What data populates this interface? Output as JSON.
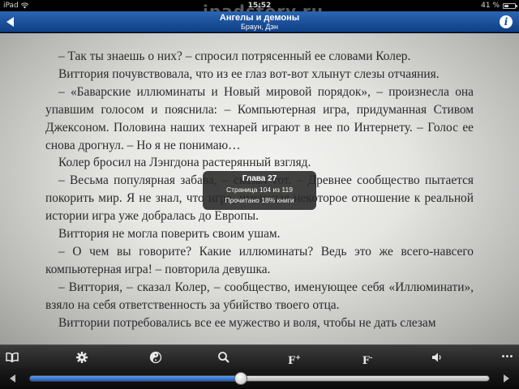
{
  "status_bar": {
    "carrier": "iPad",
    "time": "15:52",
    "battery_text": "41 %",
    "battery_level": 0.41
  },
  "watermark": "ipadstory.ru",
  "nav": {
    "title": "Ангелы и демоны",
    "author": "Браун, Дэн",
    "info_label": "i"
  },
  "page": {
    "paragraphs": [
      "– Так ты знаешь о них? – спросил потрясенный ее словами Колер.",
      "Виттория почувствовала, что из ее глаз вот-вот хлынут слезы отчаяния.",
      "– «Баварские иллюминаты и Новый мировой порядок», – произнесла она упавшим голосом и пояснила: – Компьютерная игра, придуманная Стивом Джексоном. Половина наших технарей играют в нее по Интернету. – Голос ее снова дрогнул. – Но я не понимаю…",
      "Колер бросил на Лэнгдона растерянный взгляд.",
      "– Весьма популярная забава, – сказал тот. – Древнее сообщество пытается покорить мир. Я не знал, что игра, имеющая некоторое отношение к реальной истории игра уже добралась до Европы.",
      "Виттория не могла поверить своим ушам.",
      "– О чем вы говорите? Какие иллюминаты? Ведь это же всего-навсего компьютерная игра! – повторила девушка.",
      "– Виттория, – сказал Колер, – сообщество, именующее себя «Иллюминати», взяло на себя ответственность за убийство твоего отца.",
      "Виттории потребовались все ее мужество и воля, чтобы не дать слезам"
    ]
  },
  "popup": {
    "chapter": "Глава 27",
    "pages": "Страница 104 из 119",
    "progress": "Прочитано 18% книги"
  },
  "toolbar": {
    "font_increase_label": "F",
    "font_increase_sup": "+",
    "font_decrease_label": "F",
    "font_decrease_sup": "-",
    "more_label": "•••"
  },
  "slider": {
    "position": 0.46
  }
}
